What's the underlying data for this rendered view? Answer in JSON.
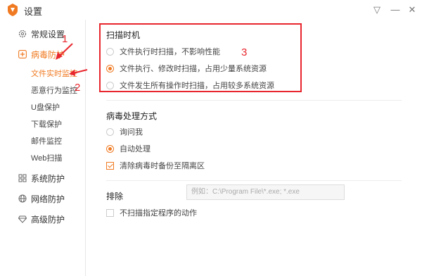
{
  "window": {
    "title": "设置"
  },
  "titlebar_buttons": [
    {
      "name": "dropdown-button",
      "glyph": "▽"
    },
    {
      "name": "minimize-button",
      "glyph": "—"
    },
    {
      "name": "close-button",
      "glyph": "✕"
    }
  ],
  "sidebar": {
    "items": [
      {
        "label": "常规设置",
        "icon": "gear-icon"
      },
      {
        "label": "病毒防护",
        "icon": "plus-shield-icon",
        "active": true
      },
      {
        "label": "系统防护",
        "icon": "system-icon"
      },
      {
        "label": "网络防护",
        "icon": "globe-icon"
      },
      {
        "label": "高级防护",
        "icon": "diamond-icon"
      }
    ],
    "subitems": [
      {
        "label": "文件实时监控",
        "active": true
      },
      {
        "label": "恶意行为监控"
      },
      {
        "label": "U盘保护"
      },
      {
        "label": "下载保护"
      },
      {
        "label": "邮件监控"
      },
      {
        "label": "Web扫描"
      }
    ]
  },
  "scan_timing": {
    "title": "扫描时机",
    "options": [
      {
        "label": "文件执行时扫描，不影响性能",
        "selected": false
      },
      {
        "label": "文件执行、修改时扫描，占用少量系统资源",
        "selected": true
      },
      {
        "label": "文件发生所有操作时扫描，占用较多系统资源",
        "selected": false
      }
    ]
  },
  "virus_handling": {
    "title": "病毒处理方式",
    "options": [
      {
        "label": "询问我",
        "selected": false
      },
      {
        "label": "自动处理",
        "selected": true
      }
    ],
    "backup_checkbox": {
      "label": "清除病毒时备份至隔离区",
      "checked": true
    }
  },
  "exclude": {
    "title": "排除",
    "checkbox": {
      "label": "不扫描指定程序的动作",
      "checked": false
    },
    "input_placeholder": "例如：C:\\Program File\\*.exe; *.exe"
  },
  "annotations": {
    "num1": "1",
    "num2": "2",
    "num3": "3",
    "color": "#e8262d"
  },
  "colors": {
    "accent": "#f07a22"
  }
}
